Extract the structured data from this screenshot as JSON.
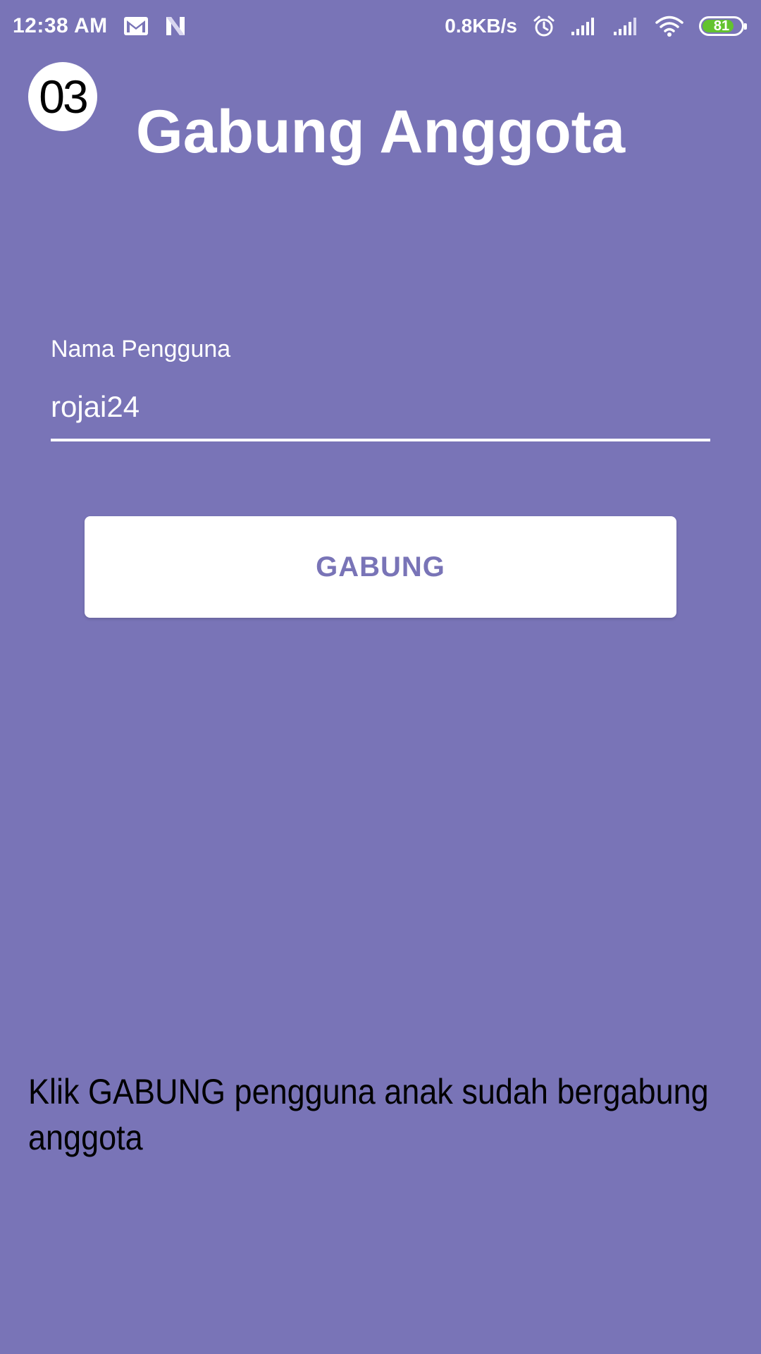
{
  "status_bar": {
    "time": "12:38 AM",
    "network_speed": "0.8KB/s",
    "battery_level": "81",
    "battery_fraction": 0.81,
    "icons": [
      "gmail-icon",
      "notification-n-icon",
      "alarm-icon",
      "signal-icon",
      "signal-icon",
      "wifi-icon",
      "battery-icon"
    ],
    "battery_color": "#63c32f"
  },
  "step_badge": "03",
  "page": {
    "title": "Gabung Anggota",
    "background_color": "#7974b7"
  },
  "form": {
    "username_label": "Nama Pengguna",
    "username_value": "rojai24",
    "submit_label": "GABUNG"
  },
  "caption": "Klik GABUNG pengguna anak sudah bergabung anggota"
}
